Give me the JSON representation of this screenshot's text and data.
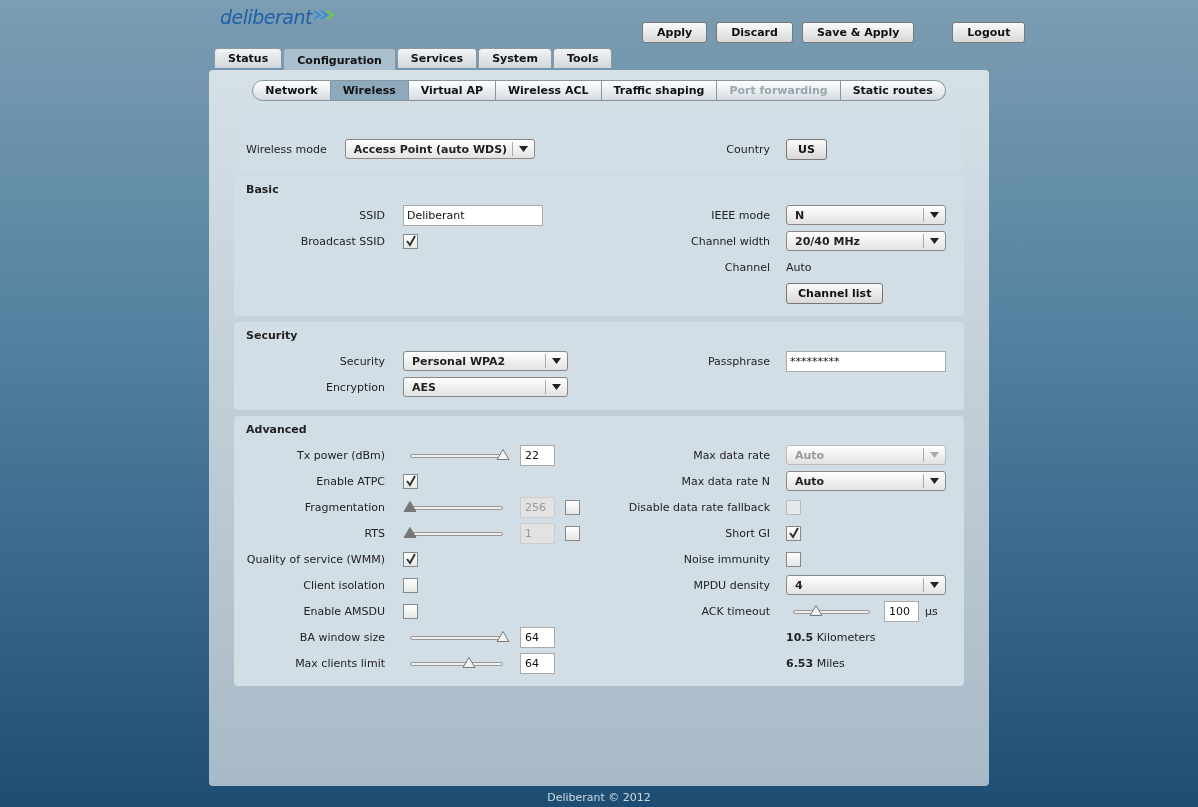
{
  "logo": "deliberant",
  "action_buttons": [
    "Apply",
    "Discard",
    "Save & Apply"
  ],
  "logout_button": "Logout",
  "main_tabs": [
    {
      "label": "Status",
      "selected": false
    },
    {
      "label": "Configuration",
      "selected": true
    },
    {
      "label": "Services",
      "selected": false
    },
    {
      "label": "System",
      "selected": false
    },
    {
      "label": "Tools",
      "selected": false
    }
  ],
  "sub_tabs": [
    {
      "label": "Network",
      "selected": false,
      "disabled": false
    },
    {
      "label": "Wireless",
      "selected": true,
      "disabled": false
    },
    {
      "label": "Virtual AP",
      "selected": false,
      "disabled": false
    },
    {
      "label": "Wireless ACL",
      "selected": false,
      "disabled": false
    },
    {
      "label": "Traffic shaping",
      "selected": false,
      "disabled": false
    },
    {
      "label": "Port forwarding",
      "selected": false,
      "disabled": true
    },
    {
      "label": "Static routes",
      "selected": false,
      "disabled": false
    }
  ],
  "sections": [
    {
      "left": [
        {
          "kind": "select",
          "label": "Wireless mode",
          "value": "Access Point (auto WDS)",
          "disabled": false
        }
      ],
      "right": [
        {
          "kind": "button",
          "label": "Country",
          "value": "US"
        }
      ]
    },
    {
      "title": "Basic",
      "left": [
        {
          "kind": "text",
          "label": "SSID",
          "value": "Deliberant"
        },
        {
          "kind": "checkbox",
          "label": "Broadcast SSID",
          "checked": true,
          "disabled": false
        }
      ],
      "right": [
        {
          "kind": "select",
          "label": "IEEE mode",
          "value": "N",
          "disabled": false
        },
        {
          "kind": "select",
          "label": "Channel width",
          "value": "20/40 MHz",
          "disabled": false
        },
        {
          "kind": "static",
          "label": "Channel",
          "value": "Auto"
        },
        {
          "kind": "button",
          "value": "Channel list"
        }
      ]
    },
    {
      "title": "Security",
      "left": [
        {
          "kind": "select",
          "label": "Security",
          "value": "Personal WPA2",
          "disabled": false
        },
        {
          "kind": "select",
          "label": "Encryption",
          "value": "AES",
          "disabled": false
        }
      ],
      "right": [
        {
          "kind": "text",
          "label": "Passphrase",
          "value": "*********"
        }
      ]
    },
    {
      "title": "Advanced",
      "left": [
        {
          "kind": "slider",
          "label": "Tx power (dBm)",
          "level": 1,
          "value": "22",
          "disabled": false
        },
        {
          "kind": "checkbox",
          "label": "Enable ATPC",
          "checked": true,
          "disabled": false
        },
        {
          "kind": "slider",
          "label": "Fragmentation",
          "level": 0,
          "value": "256",
          "disabled": true,
          "toggle_checked": false
        },
        {
          "kind": "slider",
          "label": "RTS",
          "level": 0,
          "value": "1",
          "disabled": true,
          "toggle_checked": false
        },
        {
          "kind": "checkbox",
          "label": "Quality of service (WMM)",
          "checked": true,
          "disabled": false
        },
        {
          "kind": "checkbox",
          "label": "Client isolation",
          "checked": false,
          "disabled": false
        },
        {
          "kind": "checkbox",
          "label": "Enable AMSDU",
          "checked": false,
          "disabled": false
        },
        {
          "kind": "slider",
          "label": "BA window size",
          "level": 1,
          "value": "64",
          "disabled": false
        },
        {
          "kind": "slider",
          "label": "Max clients limit",
          "level": 0.63,
          "value": "64",
          "disabled": false
        }
      ],
      "right": [
        {
          "kind": "select",
          "label": "Max data rate",
          "value": "Auto",
          "disabled": true
        },
        {
          "kind": "select",
          "label": "Max data rate N",
          "value": "Auto",
          "disabled": false
        },
        {
          "kind": "checkbox",
          "label": "Disable data rate fallback",
          "checked": false,
          "disabled": true
        },
        {
          "kind": "checkbox",
          "label": "Short GI",
          "checked": true,
          "disabled": false
        },
        {
          "kind": "checkbox",
          "label": "Noise immunity",
          "checked": false,
          "disabled": false
        },
        {
          "kind": "select",
          "label": "MPDU density",
          "value": "4",
          "disabled": false
        },
        {
          "kind": "slider",
          "label": "ACK timeout",
          "level": 0.3,
          "value": "100",
          "unit": "µs",
          "disabled": false
        },
        {
          "kind": "readout",
          "value": "**10.5** Kilometers"
        },
        {
          "kind": "readout",
          "value": "**6.53** Miles"
        }
      ]
    }
  ],
  "footer": "Deliberant © 2012"
}
